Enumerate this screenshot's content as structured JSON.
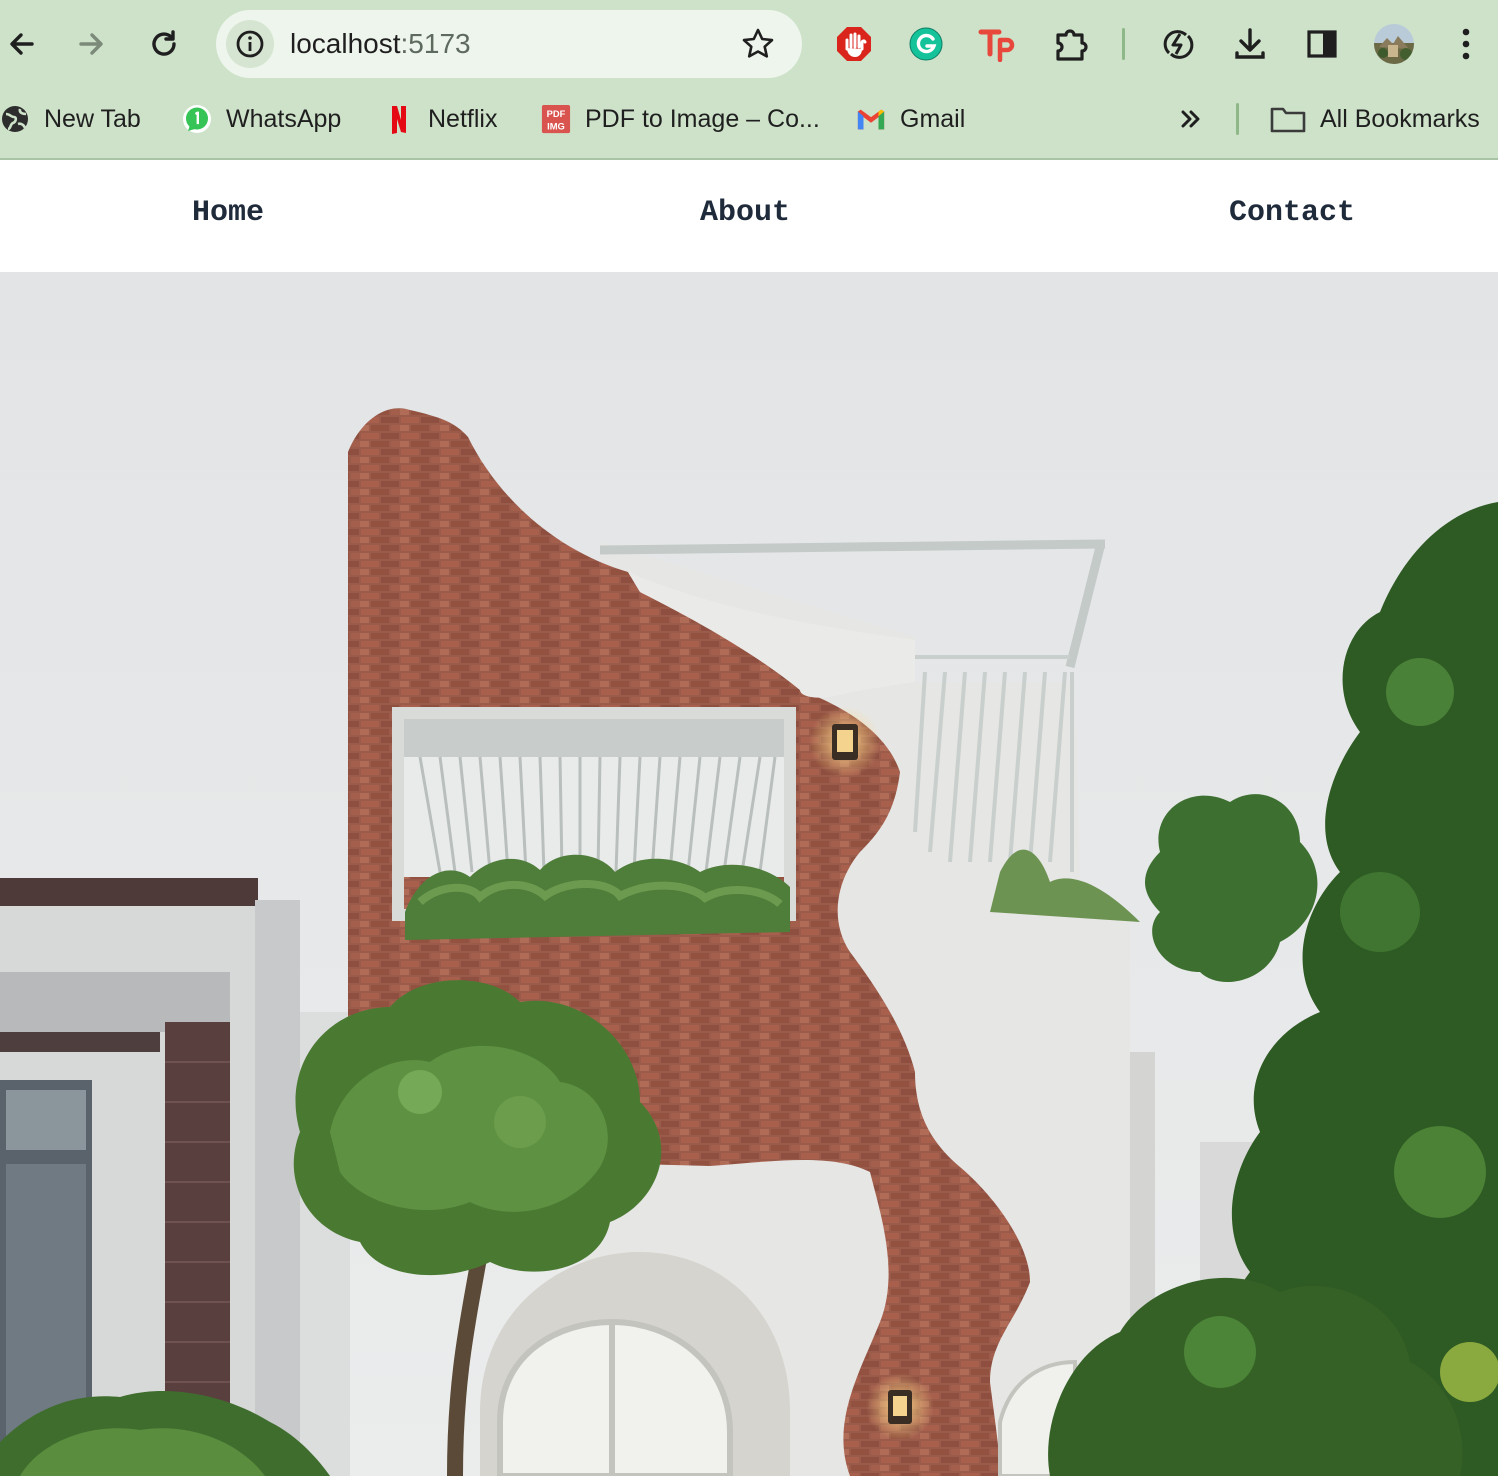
{
  "browser": {
    "url_host": "localhost",
    "url_port": ":5173",
    "bookmarks": [
      {
        "label": "New Tab",
        "icon": "globe-icon"
      },
      {
        "label": "WhatsApp",
        "icon": "whatsapp-icon"
      },
      {
        "label": "Netflix",
        "icon": "netflix-icon"
      },
      {
        "label": "PDF to Image – Co...",
        "icon": "pdf-img-icon"
      },
      {
        "label": "Gmail",
        "icon": "gmail-icon"
      }
    ],
    "all_bookmarks_label": "All Bookmarks",
    "colors": {
      "chrome_bg": "#cde2c9",
      "omnibox_bg": "#eef5ec"
    }
  },
  "site": {
    "nav": {
      "home": "Home",
      "about": "About",
      "contact": "Contact"
    },
    "hero_image": "photo of modern white house with curved exposed red brick facade, planter balcony and trees"
  }
}
